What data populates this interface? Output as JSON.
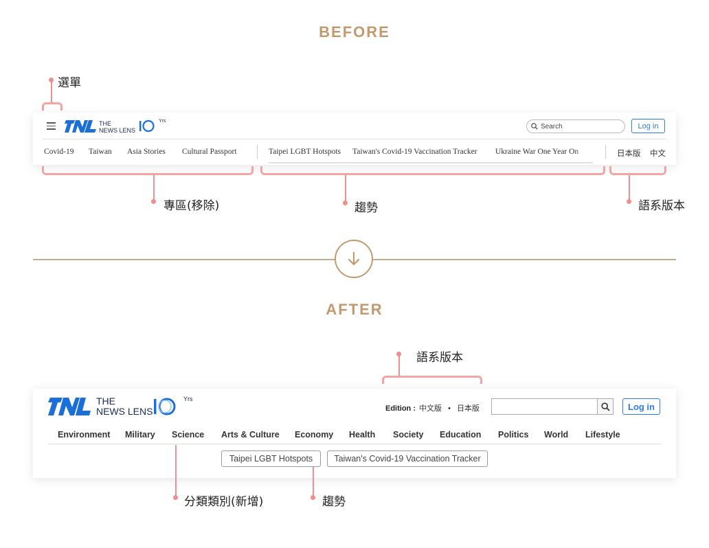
{
  "headings": {
    "before": "BEFORE",
    "after": "AFTER"
  },
  "annotations": {
    "menu": "選單",
    "columns_removed": "專區(移除)",
    "trending_before": "趨勢",
    "language_before": "語系版本",
    "language_after": "語系版本",
    "categories_added": "分類類別(新增)",
    "trending_after": "趨勢"
  },
  "before": {
    "brand": {
      "line1": "THE",
      "line2": "NEWS LENS",
      "badge": "Yrs"
    },
    "search_placeholder": "Search",
    "login_label": "Log in",
    "columns": [
      "Covid-19",
      "Taiwan",
      "Asia Stories",
      "Cultural Passport"
    ],
    "trending": [
      "Taipei LGBT Hotspots",
      "Taiwan's Covid-19 Vaccination Tracker",
      "Ukraine War One Year On"
    ],
    "languages": [
      "日本版",
      "中文"
    ]
  },
  "after": {
    "brand": {
      "line1": "THE",
      "line2": "NEWS LENS",
      "badge": "Yrs"
    },
    "edition_label": "Edition :",
    "edition_current": "中文版",
    "edition_separator": "•",
    "edition_other": "日本版",
    "login_label": "Log in",
    "categories": [
      "Environment",
      "Military",
      "Science",
      "Arts & Culture",
      "Economy",
      "Health",
      "Society",
      "Education",
      "Politics",
      "World",
      "Lifestyle"
    ],
    "trending": [
      "Taipei LGBT Hotspots",
      "Taiwan's Covid-19 Vaccination Tracker"
    ]
  },
  "colors": {
    "accent_gold": "#c29a6e",
    "annotation_pink": "#f08d8d",
    "brand_blue": "#2b7de0",
    "logo_blue": "#1a6fd8"
  }
}
